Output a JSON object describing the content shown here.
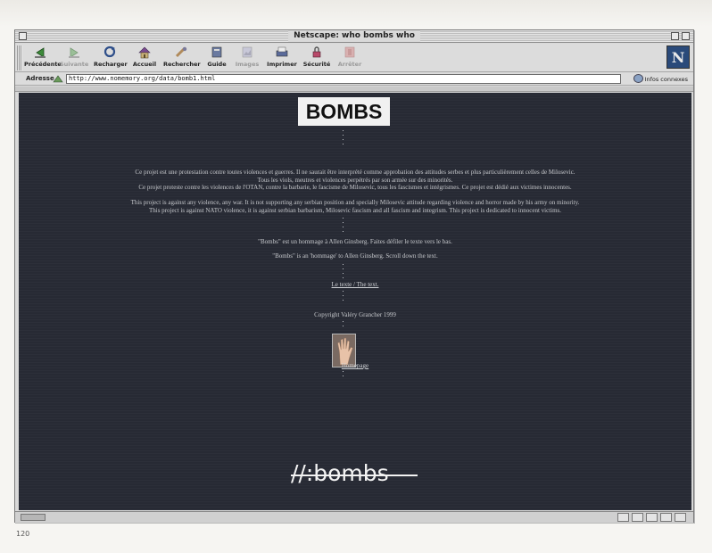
{
  "window": {
    "title": "Netscape: who bombs who"
  },
  "toolbar": {
    "buttons": [
      {
        "label": "Précédente",
        "icon": "back-arrow-icon",
        "enabled": true
      },
      {
        "label": "Suivante",
        "icon": "forward-arrow-icon",
        "enabled": false
      },
      {
        "label": "Recharger",
        "icon": "reload-icon",
        "enabled": true
      },
      {
        "label": "Accueil",
        "icon": "home-icon",
        "enabled": true
      },
      {
        "label": "Rechercher",
        "icon": "search-icon",
        "enabled": true
      },
      {
        "label": "Guide",
        "icon": "guide-icon",
        "enabled": true
      },
      {
        "label": "Images",
        "icon": "images-icon",
        "enabled": false
      },
      {
        "label": "Imprimer",
        "icon": "print-icon",
        "enabled": true
      },
      {
        "label": "Sécurité",
        "icon": "security-lock-icon",
        "enabled": true
      },
      {
        "label": "Arrêter",
        "icon": "stop-icon",
        "enabled": false
      }
    ],
    "throbber_letter": "N"
  },
  "address": {
    "label": "Adresse",
    "url": "http://www.nomemory.org/data/bomb1.html",
    "infos_label": "Infos connexes"
  },
  "page": {
    "logo_text": "BOMBS",
    "fr_paragraph": [
      "Ce projet est une protestation contre toutes violences et guerres. Il ne saurait être interprété comme approbation des attitudes serbes et plus particulièrement celles de Milosevic.",
      "Tous les viols, meutres et violences perpétrés par son armée sur des minorités.",
      "Ce projet proteste contre les violences de l'OTAN, contre la barbarie, le fascisme de Milosevic, tous les fascismes et intégrismes. Ce projet est dédié aux victimes innocentes."
    ],
    "en_paragraph": [
      "This project is against any violence, any war. It is not supporting any serbian position and specially Milosevic attitude regarding violence and horror made by his army on minority.",
      "This project is against NATO violence, it is against serbian barbarism, Milosevic fascism and all fascism and integrism. This project is dedicated to innocent victims."
    ],
    "hommage_fr": "\"Bombs\" est un hommage à Allen Ginsberg. Faites défiler le texte vers le bas.",
    "hommage_en": "\"Bombs\" is an 'hommage' to Allen Ginsberg. Scroll down the text.",
    "text_link": "Le texte / The text.",
    "copyright": "Copyright Valéry Grancher 1999",
    "homepage_link": "Homepage",
    "wordmark": "//:bombs"
  },
  "print": {
    "page_number": "120"
  }
}
